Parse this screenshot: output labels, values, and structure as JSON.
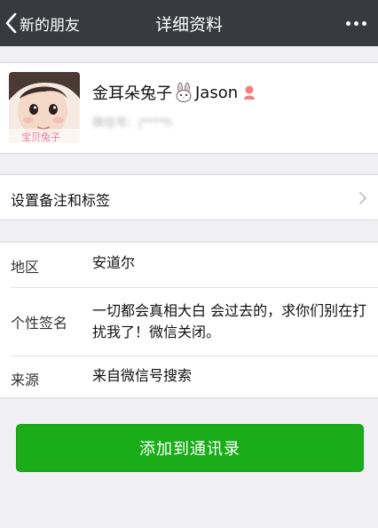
{
  "navbar": {
    "back_label": "新的朋友",
    "title": "详细资料",
    "back_icon": "chevron-left-icon",
    "more_icon": "more-dots-icon"
  },
  "profile": {
    "name_part1": "金耳朵兔子",
    "name_part2": "Jason",
    "wechat_id": "微信号：j****h",
    "avatar_caption": "宝贝兔子",
    "gender": "female",
    "emoji_icon": "rabbit-icon"
  },
  "remark": {
    "label": "设置备注和标签"
  },
  "info": {
    "region_label": "地区",
    "region_value": "安道尔",
    "signature_label": "个性签名",
    "signature_value": "一切都会真相大白 会过去的，求你们别在打扰我了！微信关闭。",
    "source_label": "来源",
    "source_value": "来自微信号搜索"
  },
  "actions": {
    "add_contact_label": "添加到通讯录"
  },
  "colors": {
    "navbar": "#393a3f",
    "primary_button": "#1aad19",
    "background": "#efeff4"
  }
}
